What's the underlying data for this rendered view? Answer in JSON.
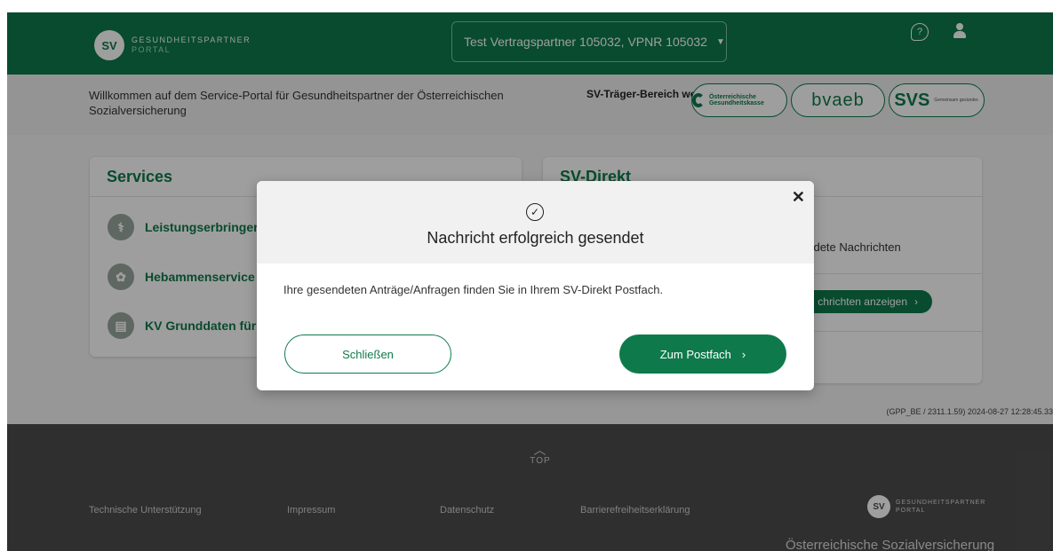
{
  "header": {
    "brand_name": "GESUNDHEITSPARTNER",
    "brand_sub": "PORTAL",
    "logo_text": "SV",
    "partner_select": "Test Vertragspartner 105032, VPNR 105032"
  },
  "band": {
    "welcome": "Willkommen auf dem Service-Portal für Gesundheitspartner der Österreichischen Sozialversicherung",
    "switch_label": "SV-Träger-Bereich wechseln",
    "carriers": {
      "ogk": "Österreichische Gesundheitskasse",
      "bvaeb": "bvaeb",
      "svs": "SVS",
      "svs_tag": "Gemeinsam gesünder."
    }
  },
  "services": {
    "title": "Services",
    "items": [
      "Leistungserbringer",
      "Hebammenservice",
      "KV Grunddaten für"
    ]
  },
  "direkt": {
    "title": "SV-Direkt",
    "sent_messages": "endete Nachrichten",
    "show_button": "chrichten anzeigen"
  },
  "version": "(GPP_BE / 2311.1.59) 2024-08-27 12:28:45.33",
  "footer": {
    "top_label": "TOP",
    "links": [
      "Technische Unterstützung",
      "Impressum",
      "Datenschutz",
      "Barrierefreiheitserklärung"
    ],
    "brand_name": "GESUNDHEITSPARTNER",
    "brand_sub": "PORTAL",
    "logo_text": "SV",
    "org": "Österreichische Sozialversicherung"
  },
  "modal": {
    "title": "Nachricht erfolgreich gesendet",
    "text": "Ihre gesendeten Anträge/Anfragen finden Sie in Ihrem SV-Direkt Postfach.",
    "close_label": "Schließen",
    "inbox_label": "Zum Postfach"
  },
  "colors": {
    "brand_green": "#0e7a4b",
    "footer_grey": "#4d4d4d"
  }
}
